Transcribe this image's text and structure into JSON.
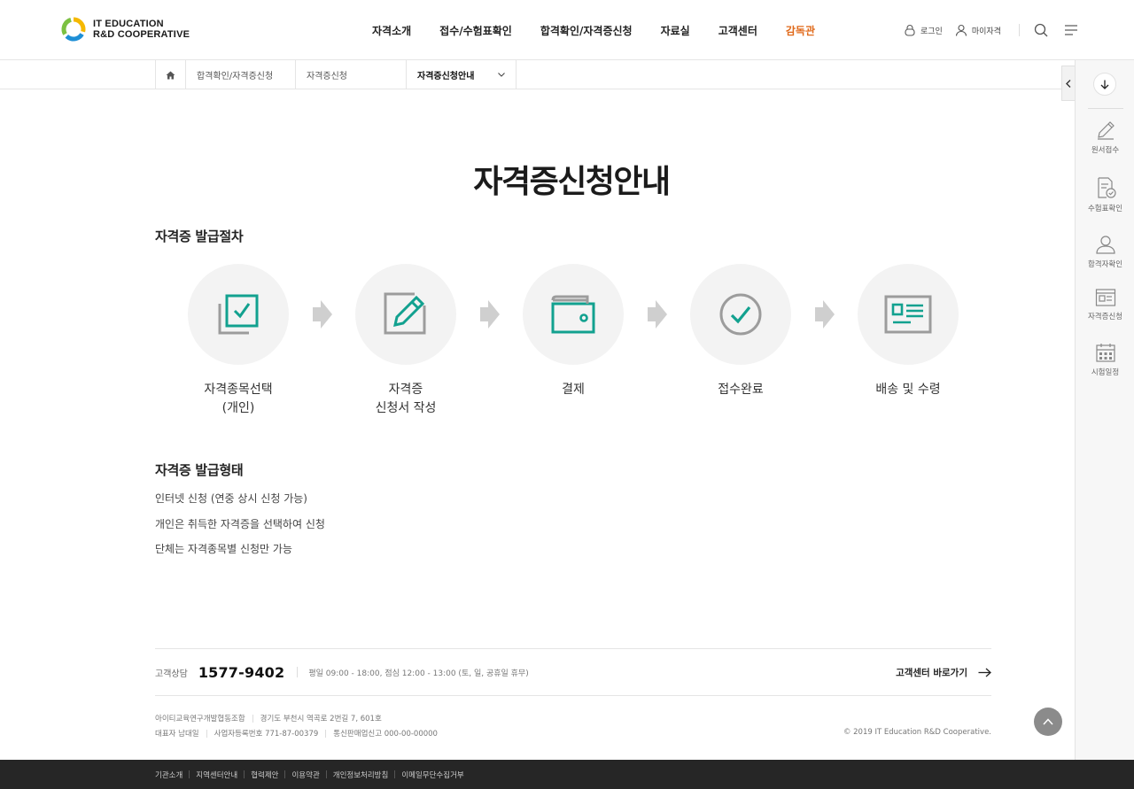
{
  "header": {
    "logo_line1": "IT EDUCATION",
    "logo_line2": "R&D COOPERATIVE",
    "nav": [
      "자격소개",
      "접수/수험표확인",
      "합격확인/자격증신청",
      "자료실",
      "고객센터",
      "감독관"
    ],
    "highlight_color": "#e06a1b",
    "login_label": "로그인",
    "mypage_label": "마이자격"
  },
  "breadcrumb": {
    "items": [
      "합격확인/자격증신청",
      "자격증신청",
      "자격증신청안내"
    ]
  },
  "sidebar": {
    "items": [
      {
        "label": "원서접수",
        "icon": "pencil-icon"
      },
      {
        "label": "수험표확인",
        "icon": "document-check-icon"
      },
      {
        "label": "합격자확인",
        "icon": "person-icon"
      },
      {
        "label": "자격증신청",
        "icon": "certificate-icon"
      },
      {
        "label": "시험일정",
        "icon": "calendar-icon"
      }
    ]
  },
  "main": {
    "title": "자격증신청안내",
    "section1_title": "자격증 발급절차",
    "steps": [
      {
        "line1": "자격종목선택",
        "line2": "(개인)",
        "icon": "checkbox-icon"
      },
      {
        "line1": "자격증",
        "line2": "신청서 작성",
        "icon": "edit-icon"
      },
      {
        "line1": "결제",
        "line2": "",
        "icon": "wallet-icon"
      },
      {
        "line1": "접수완료",
        "line2": "",
        "icon": "check-circle-icon"
      },
      {
        "line1": "배송 및 수령",
        "line2": "",
        "icon": "id-card-icon"
      }
    ],
    "accent_color": "#12a18f",
    "section2_title": "자격증 발급형태",
    "info": [
      "인터넷 신청 (연중 상시 신청 가능)",
      "개인은 취득한 자격증을 선택하여 신청",
      "단체는 자격종목별 신청만 가능"
    ]
  },
  "footer": {
    "cs_label": "고객상담",
    "cs_phone": "1577-9402",
    "cs_hours": "평일 09:00 - 18:00, 점심 12:00 - 13:00 (토, 일, 공휴일 휴무)",
    "cs_link": "고객센터 바로가기",
    "org_name": "아이티교육연구개발협동조합",
    "address": "경기도 부천시 역곡로 2번길 7, 601호",
    "ceo": "대표자 남대일",
    "biz_no": "사업자등록번호 771-87-00379",
    "sales_no": "통신판매업신고 000-00-00000",
    "copyright": "© 2019 IT Education R&D Cooperative.",
    "bottom_links": [
      "기관소개",
      "지역센터안내",
      "협력제안",
      "이용약관",
      "개인정보처리방침",
      "이메일무단수집거부"
    ]
  }
}
